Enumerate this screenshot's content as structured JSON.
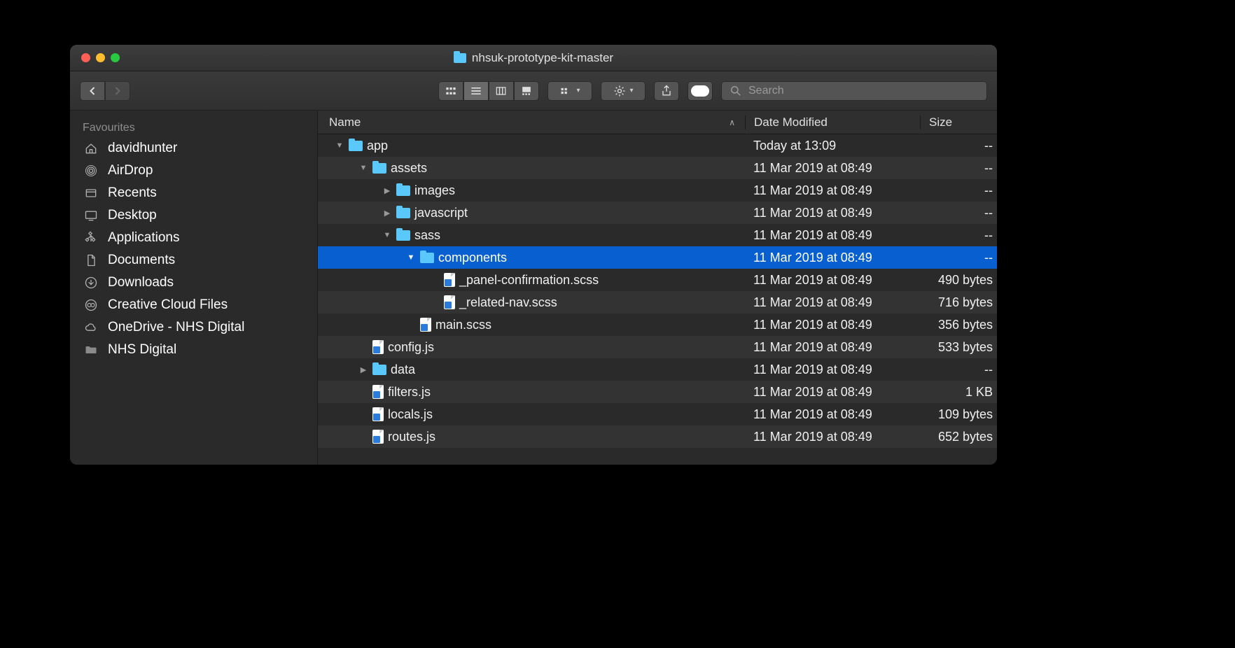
{
  "window": {
    "title": "nhsuk-prototype-kit-master"
  },
  "search": {
    "placeholder": "Search"
  },
  "sidebar": {
    "header": "Favourites",
    "items": [
      {
        "label": "davidhunter",
        "icon": "home"
      },
      {
        "label": "AirDrop",
        "icon": "airdrop"
      },
      {
        "label": "Recents",
        "icon": "recents"
      },
      {
        "label": "Desktop",
        "icon": "desktop"
      },
      {
        "label": "Applications",
        "icon": "apps"
      },
      {
        "label": "Documents",
        "icon": "documents"
      },
      {
        "label": "Downloads",
        "icon": "downloads"
      },
      {
        "label": "Creative Cloud Files",
        "icon": "cc"
      },
      {
        "label": "OneDrive - NHS Digital",
        "icon": "cloud"
      },
      {
        "label": "NHS Digital",
        "icon": "folder"
      }
    ]
  },
  "columns": {
    "name": "Name",
    "date": "Date Modified",
    "size": "Size"
  },
  "rows": [
    {
      "name": "app",
      "type": "folder",
      "indent": 0,
      "expanded": true,
      "date": "Today at 13:09",
      "size": "--",
      "selected": false
    },
    {
      "name": "assets",
      "type": "folder",
      "indent": 1,
      "expanded": true,
      "date": "11 Mar 2019 at 08:49",
      "size": "--",
      "selected": false
    },
    {
      "name": "images",
      "type": "folder",
      "indent": 2,
      "expanded": false,
      "date": "11 Mar 2019 at 08:49",
      "size": "--",
      "selected": false
    },
    {
      "name": "javascript",
      "type": "folder",
      "indent": 2,
      "expanded": false,
      "date": "11 Mar 2019 at 08:49",
      "size": "--",
      "selected": false
    },
    {
      "name": "sass",
      "type": "folder",
      "indent": 2,
      "expanded": true,
      "date": "11 Mar 2019 at 08:49",
      "size": "--",
      "selected": false
    },
    {
      "name": "components",
      "type": "folder",
      "indent": 3,
      "expanded": true,
      "date": "11 Mar 2019 at 08:49",
      "size": "--",
      "selected": true
    },
    {
      "name": "_panel-confirmation.scss",
      "type": "file",
      "indent": 4,
      "date": "11 Mar 2019 at 08:49",
      "size": "490 bytes",
      "selected": false
    },
    {
      "name": "_related-nav.scss",
      "type": "file",
      "indent": 4,
      "date": "11 Mar 2019 at 08:49",
      "size": "716 bytes",
      "selected": false
    },
    {
      "name": "main.scss",
      "type": "file",
      "indent": 3,
      "date": "11 Mar 2019 at 08:49",
      "size": "356 bytes",
      "selected": false
    },
    {
      "name": "config.js",
      "type": "file",
      "indent": 1,
      "date": "11 Mar 2019 at 08:49",
      "size": "533 bytes",
      "selected": false
    },
    {
      "name": "data",
      "type": "folder",
      "indent": 1,
      "expanded": false,
      "date": "11 Mar 2019 at 08:49",
      "size": "--",
      "selected": false
    },
    {
      "name": "filters.js",
      "type": "file",
      "indent": 1,
      "date": "11 Mar 2019 at 08:49",
      "size": "1 KB",
      "selected": false
    },
    {
      "name": "locals.js",
      "type": "file",
      "indent": 1,
      "date": "11 Mar 2019 at 08:49",
      "size": "109 bytes",
      "selected": false
    },
    {
      "name": "routes.js",
      "type": "file",
      "indent": 1,
      "date": "11 Mar 2019 at 08:49",
      "size": "652 bytes",
      "selected": false
    }
  ]
}
